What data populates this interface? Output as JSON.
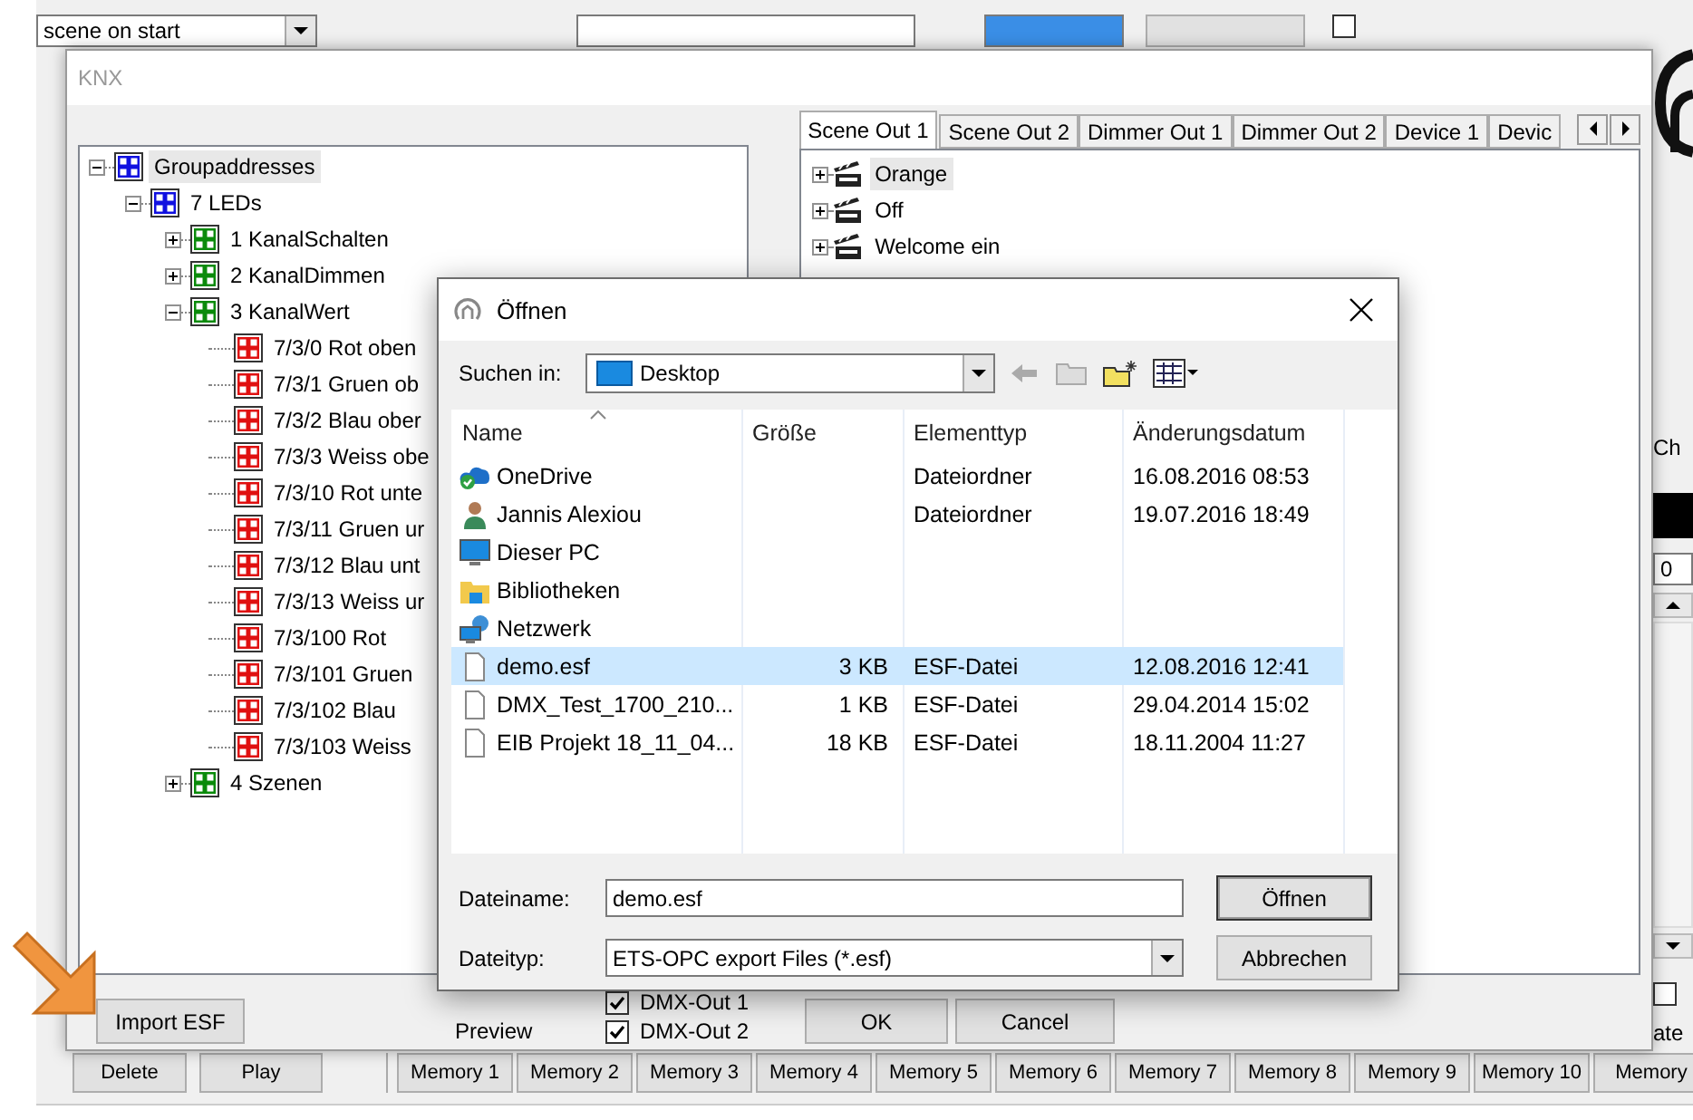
{
  "background_app": {
    "scene_dropdown": "scene on start",
    "top_checkbox": {
      "checked": false
    },
    "channel_label": "Ch",
    "channel_value": "0",
    "side_checkbox": {
      "checked": false
    },
    "side_text": "ate",
    "action_buttons": [
      "Delete",
      "Play"
    ],
    "memory_buttons": [
      "Memory 1",
      "Memory 2",
      "Memory 3",
      "Memory 4",
      "Memory 5",
      "Memory 6",
      "Memory 7",
      "Memory 8",
      "Memory 9",
      "Memory 10",
      "Memory"
    ]
  },
  "knx_window": {
    "title": "KNX",
    "tree": [
      {
        "label": "Groupaddresses",
        "kind": "main_group",
        "expanded": true,
        "selected": true,
        "children": [
          {
            "label": "7 LEDs",
            "kind": "main_group",
            "expanded": true,
            "selected": false,
            "children": [
              {
                "label": "1 KanalSchalten",
                "kind": "middle_group",
                "expanded": false,
                "selected": false
              },
              {
                "label": "2 KanalDimmen",
                "kind": "middle_group",
                "expanded": false,
                "selected": false
              },
              {
                "label": "3 KanalWert",
                "kind": "middle_group",
                "expanded": true,
                "selected": false,
                "children": [
                  {
                    "label": "7/3/0 Rot oben",
                    "kind": "address",
                    "selected": false
                  },
                  {
                    "label": "7/3/1 Gruen ob",
                    "kind": "address",
                    "selected": false
                  },
                  {
                    "label": "7/3/2 Blau ober",
                    "kind": "address",
                    "selected": false
                  },
                  {
                    "label": "7/3/3 Weiss obe",
                    "kind": "address",
                    "selected": false
                  },
                  {
                    "label": "7/3/10 Rot unte",
                    "kind": "address",
                    "selected": false
                  },
                  {
                    "label": "7/3/11 Gruen ur",
                    "kind": "address",
                    "selected": false
                  },
                  {
                    "label": "7/3/12 Blau unt",
                    "kind": "address",
                    "selected": false
                  },
                  {
                    "label": "7/3/13 Weiss ur",
                    "kind": "address",
                    "selected": false
                  },
                  {
                    "label": "7/3/100 Rot",
                    "kind": "address",
                    "selected": false
                  },
                  {
                    "label": "7/3/101 Gruen",
                    "kind": "address",
                    "selected": false
                  },
                  {
                    "label": "7/3/102 Blau",
                    "kind": "address",
                    "selected": false
                  },
                  {
                    "label": "7/3/103 Weiss",
                    "kind": "address",
                    "selected": false
                  }
                ]
              },
              {
                "label": "4 Szenen",
                "kind": "middle_group",
                "expanded": false,
                "selected": false
              }
            ]
          }
        ]
      }
    ],
    "tabs": [
      {
        "label": "Scene Out 1",
        "selected": true
      },
      {
        "label": "Scene Out 2",
        "selected": false
      },
      {
        "label": "Dimmer Out 1",
        "selected": false
      },
      {
        "label": "Dimmer Out 2",
        "selected": false
      },
      {
        "label": "Device 1",
        "selected": false
      },
      {
        "label": "Devic",
        "selected": false
      }
    ],
    "scenes": [
      {
        "label": "Orange",
        "expanded": false,
        "selected": true
      },
      {
        "label": "Off",
        "expanded": false,
        "selected": false
      },
      {
        "label": "Welcome ein",
        "expanded": false,
        "selected": false
      }
    ],
    "import_button": "Import ESF",
    "preview_label": "Preview",
    "outputs": [
      {
        "label": "DMX-Out 1",
        "checked": true
      },
      {
        "label": "DMX-Out 2",
        "checked": true
      }
    ],
    "ok_button": "OK",
    "cancel_button": "Cancel"
  },
  "open_dialog": {
    "title": "Öffnen",
    "look_in_label": "Suchen in:",
    "look_in_value": "Desktop",
    "columns": [
      "Name",
      "Größe",
      "Elementtyp",
      "Änderungsdatum"
    ],
    "files": [
      {
        "name": "OneDrive",
        "kind": "cloud",
        "type": "Dateiordner",
        "modified": "16.08.2016 08:53",
        "selected": false
      },
      {
        "name": "Jannis Alexiou",
        "kind": "user",
        "type": "Dateiordner",
        "modified": "19.07.2016 18:49",
        "selected": false
      },
      {
        "name": "Dieser PC",
        "kind": "computer",
        "selected": false
      },
      {
        "name": "Bibliotheken",
        "kind": "library",
        "selected": false
      },
      {
        "name": "Netzwerk",
        "kind": "network",
        "selected": false
      },
      {
        "name": "demo.esf",
        "kind": "file",
        "size": "3 KB",
        "type": "ESF-Datei",
        "modified": "12.08.2016 12:41",
        "selected": true
      },
      {
        "name": "DMX_Test_1700_210...",
        "kind": "file",
        "size": "1 KB",
        "type": "ESF-Datei",
        "modified": "29.04.2014 15:02",
        "selected": false
      },
      {
        "name": "EIB Projekt 18_11_04...",
        "kind": "file",
        "size": "18 KB",
        "type": "ESF-Datei",
        "modified": "18.11.2004 11:27",
        "selected": false
      }
    ],
    "filename_label": "Dateiname:",
    "filename_value": "demo.esf",
    "filetype_label": "Dateityp:",
    "filetype_value": "ETS-OPC export Files (*.esf)",
    "open_button": "Öffnen",
    "cancel_button": "Abbrechen"
  }
}
